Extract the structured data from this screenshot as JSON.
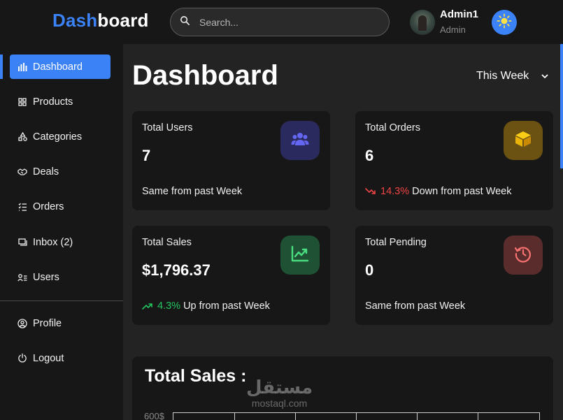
{
  "header": {
    "logo_part1": "Dash",
    "logo_part2": "board",
    "search_placeholder": "Search...",
    "user_name": "Admin1",
    "user_role": "Admin",
    "theme_icon": "sun-icon"
  },
  "sidebar": {
    "items": [
      {
        "label": "Dashboard",
        "icon": "bar-chart-icon",
        "active": true
      },
      {
        "label": "Products",
        "icon": "grid-icon"
      },
      {
        "label": "Categories",
        "icon": "shapes-icon"
      },
      {
        "label": "Deals",
        "icon": "handshake-icon"
      },
      {
        "label": "Orders",
        "icon": "list-check-icon"
      },
      {
        "label": "Inbox (2)",
        "icon": "inbox-icon"
      },
      {
        "label": "Users",
        "icon": "users-list-icon"
      }
    ],
    "bottom": [
      {
        "label": "Profile",
        "icon": "user-circle-icon"
      },
      {
        "label": "Logout",
        "icon": "power-icon"
      }
    ]
  },
  "main": {
    "title": "Dashboard",
    "period": "This Week",
    "cards": [
      {
        "title": "Total Users",
        "value": "7",
        "footer": "Same from past Week",
        "icon": "users-icon",
        "color": "#2a2a5e"
      },
      {
        "title": "Total Orders",
        "value": "6",
        "pct": "14.3%",
        "footer": "Down from past Week",
        "trend": "down",
        "icon": "box-icon",
        "color": "#6b5212"
      },
      {
        "title": "Total Sales",
        "value": "$1,796.37",
        "pct": "4.3%",
        "footer": "Up from past Week",
        "trend": "up",
        "icon": "line-chart-icon",
        "color": "#1f5235"
      },
      {
        "title": "Total Pending",
        "value": "0",
        "footer": "Same from past Week",
        "icon": "history-icon",
        "color": "#5a2c2c"
      }
    ],
    "sales": {
      "title": "Total Sales :",
      "tick": "600$"
    }
  },
  "watermark": {
    "arabic": "مستقل",
    "latin": "mostaql.com"
  },
  "colors": {
    "accent": "#3b82f6",
    "down": "#ef4444",
    "up": "#22c55e"
  }
}
